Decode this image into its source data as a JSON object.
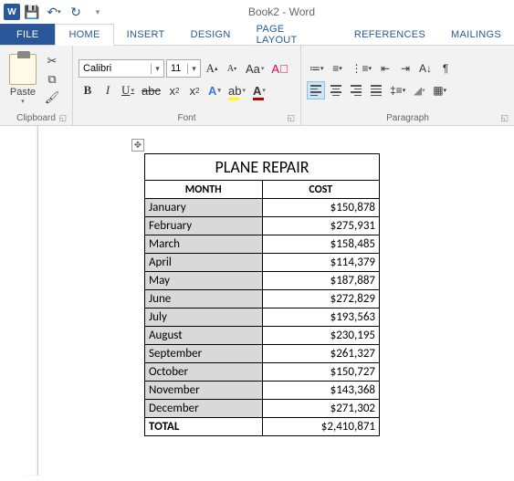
{
  "titlebar": {
    "doc_title": "Book2 - Word"
  },
  "tabs": {
    "file": "FILE",
    "home": "HOME",
    "insert": "INSERT",
    "design": "DESIGN",
    "page_layout": "PAGE LAYOUT",
    "references": "REFERENCES",
    "mailings": "MAILINGS"
  },
  "ribbon": {
    "clipboard": {
      "paste": "Paste",
      "label": "Clipboard"
    },
    "font": {
      "name": "Calibri",
      "size": "11",
      "label": "Font"
    },
    "paragraph": {
      "label": "Paragraph"
    }
  },
  "table": {
    "title": "PLANE REPAIR",
    "headers": {
      "month": "MONTH",
      "cost": "COST"
    },
    "rows": [
      {
        "month": "January",
        "cost": "$150,878"
      },
      {
        "month": "February",
        "cost": "$275,931"
      },
      {
        "month": "March",
        "cost": "$158,485"
      },
      {
        "month": "April",
        "cost": "$114,379"
      },
      {
        "month": "May",
        "cost": "$187,887"
      },
      {
        "month": "June",
        "cost": "$272,829"
      },
      {
        "month": "July",
        "cost": "$193,563"
      },
      {
        "month": "August",
        "cost": "$230,195"
      },
      {
        "month": "September",
        "cost": "$261,327"
      },
      {
        "month": "October",
        "cost": "$150,727"
      },
      {
        "month": "November",
        "cost": "$143,368"
      },
      {
        "month": "December",
        "cost": "$271,302"
      }
    ],
    "total": {
      "label": "TOTAL",
      "value": "$2,410,871"
    }
  },
  "chart_data": {
    "type": "table",
    "title": "PLANE REPAIR",
    "columns": [
      "MONTH",
      "COST"
    ],
    "rows": [
      [
        "January",
        150878
      ],
      [
        "February",
        275931
      ],
      [
        "March",
        158485
      ],
      [
        "April",
        114379
      ],
      [
        "May",
        187887
      ],
      [
        "June",
        272829
      ],
      [
        "July",
        193563
      ],
      [
        "August",
        230195
      ],
      [
        "September",
        261327
      ],
      [
        "October",
        150727
      ],
      [
        "November",
        143368
      ],
      [
        "December",
        271302
      ]
    ],
    "total": 2410871
  }
}
